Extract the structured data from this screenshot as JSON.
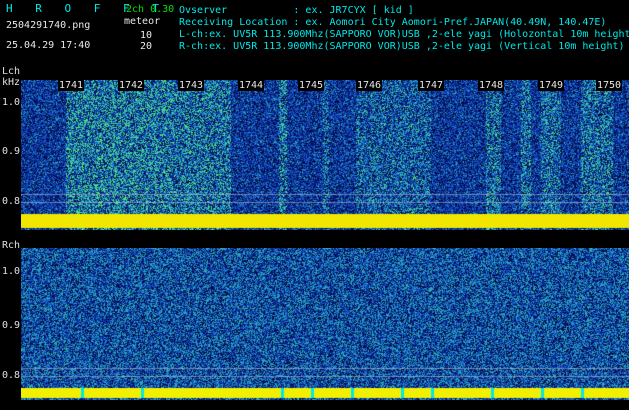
{
  "header": {
    "app_title": "H R O F F T",
    "filename": "2504291740.png",
    "datetime": "25.04.29 17:40",
    "mode": "2ch 0.30",
    "meteor_label": "meteor",
    "meteor_l": "10",
    "meteor_r": "20",
    "observer": "Ovserver           : ex. JR7CYX [ kid ]",
    "location": "Receiving Location : ex. Aomori City Aomori-Pref.JAPAN(40.49N, 140.47E)",
    "lch_info": "L-ch:ex. UV5R 113.900Mhz(SAPPORO VOR)USB ,2-ele yagi (Holozontal 10m height)",
    "rch_info": "R-ch:ex. UV5R 113.900Mhz(SAPPORO VOR)USB ,2-ele yagi (Vertical 10m height)"
  },
  "lch": {
    "label": "Lch",
    "unit": "kHz",
    "ticks": [
      "1.0",
      "0.9",
      "0.8"
    ]
  },
  "rch": {
    "label": "Rch",
    "ticks": [
      "1.0",
      "0.9",
      "0.8"
    ]
  },
  "time_markers": [
    "1741",
    "1742",
    "1743",
    "1744",
    "1745",
    "1746",
    "1747",
    "1748",
    "1749",
    "1750"
  ],
  "colors": {
    "cyan": "#00e8e8",
    "yellow": "#f0f000",
    "background": "#000000"
  }
}
